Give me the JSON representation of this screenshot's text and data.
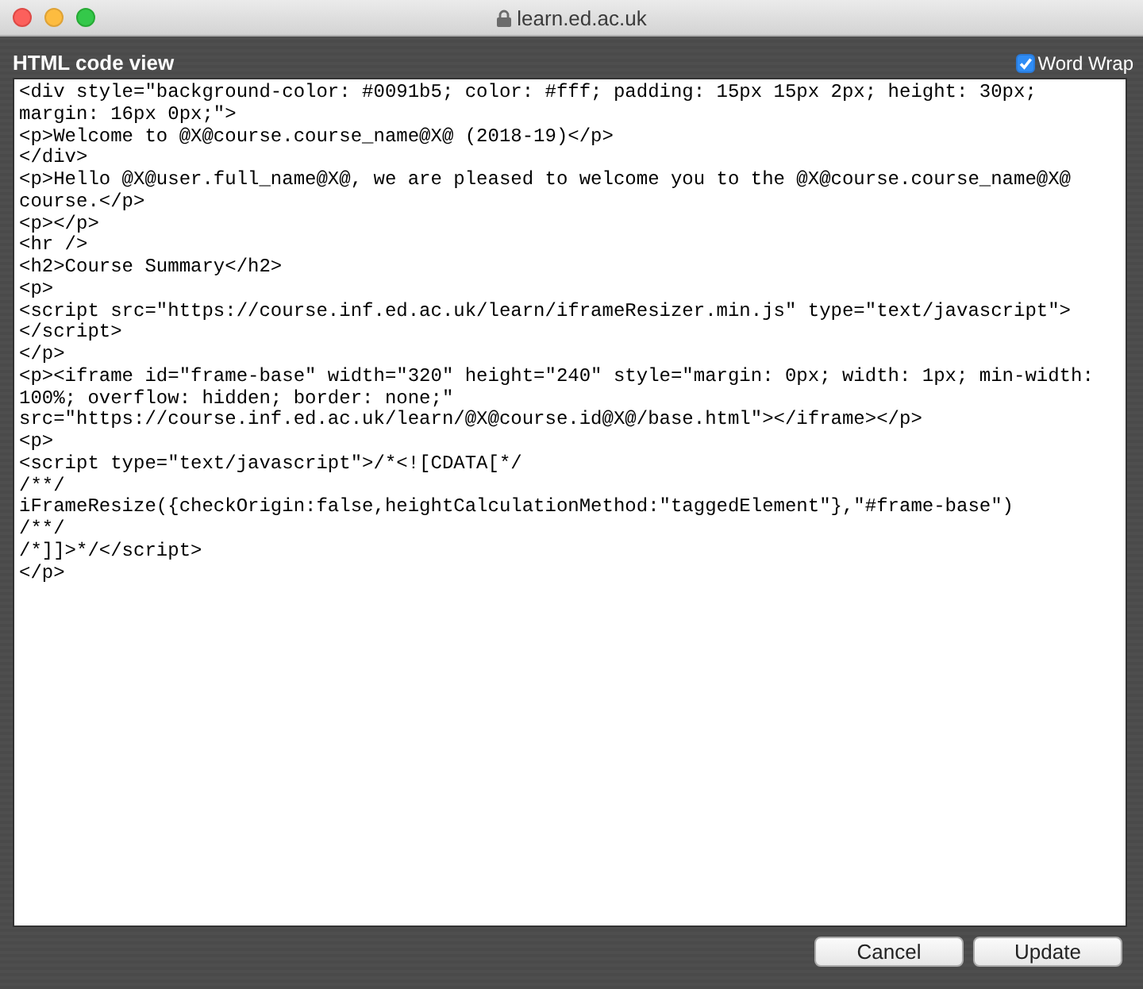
{
  "window": {
    "title": "learn.ed.ac.uk"
  },
  "dialog": {
    "title": "HTML code view",
    "word_wrap": {
      "label": "Word Wrap",
      "checked": true
    }
  },
  "code_lines": [
    "<div style=\"background-color: #0091b5; color: #fff; padding: 15px 15px 2px; height: 30px;",
    "margin: 16px 0px;\">",
    "<p>Welcome to @X@course.course_name@X@ (2018-19)</p>",
    "</div>",
    "<p>Hello @X@user.full_name@X@, we are pleased to welcome you to the @X@course.course_name@X@",
    "course.</p>",
    "<p></p>",
    "<hr />",
    "<h2>Course Summary</h2>",
    "<p>",
    "<script src=\"https://course.inf.ed.ac.uk/learn/iframeResizer.min.js\" type=\"text/javascript\">",
    "</script>",
    "</p>",
    "<p><iframe id=\"frame-base\" width=\"320\" height=\"240\" style=\"margin: 0px; width: 1px; min-width:",
    "100%; overflow: hidden; border: none;\"",
    "src=\"https://course.inf.ed.ac.uk/learn/@X@course.id@X@/base.html\"></iframe></p>",
    "<p>",
    "<script type=\"text/javascript\">/*<![CDATA[*/",
    "/**/",
    "iFrameResize({checkOrigin:false,heightCalculationMethod:\"taggedElement\"},\"#frame-base\")",
    "/**/",
    "/*]]>*/</script>",
    "</p>"
  ],
  "buttons": [
    {
      "label": "Cancel"
    },
    {
      "label": "Update"
    }
  ]
}
